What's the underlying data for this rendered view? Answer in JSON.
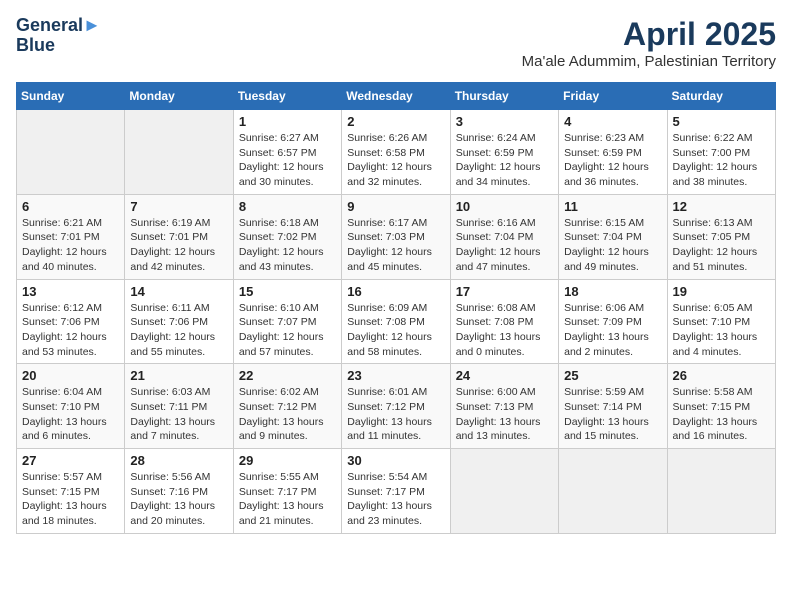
{
  "header": {
    "logo_line1": "General",
    "logo_line2": "Blue",
    "title": "April 2025",
    "subtitle": "Ma'ale Adummim, Palestinian Territory"
  },
  "weekdays": [
    "Sunday",
    "Monday",
    "Tuesday",
    "Wednesday",
    "Thursday",
    "Friday",
    "Saturday"
  ],
  "weeks": [
    [
      {
        "day": "",
        "info": ""
      },
      {
        "day": "",
        "info": ""
      },
      {
        "day": "1",
        "info": "Sunrise: 6:27 AM\nSunset: 6:57 PM\nDaylight: 12 hours and 30 minutes."
      },
      {
        "day": "2",
        "info": "Sunrise: 6:26 AM\nSunset: 6:58 PM\nDaylight: 12 hours and 32 minutes."
      },
      {
        "day": "3",
        "info": "Sunrise: 6:24 AM\nSunset: 6:59 PM\nDaylight: 12 hours and 34 minutes."
      },
      {
        "day": "4",
        "info": "Sunrise: 6:23 AM\nSunset: 6:59 PM\nDaylight: 12 hours and 36 minutes."
      },
      {
        "day": "5",
        "info": "Sunrise: 6:22 AM\nSunset: 7:00 PM\nDaylight: 12 hours and 38 minutes."
      }
    ],
    [
      {
        "day": "6",
        "info": "Sunrise: 6:21 AM\nSunset: 7:01 PM\nDaylight: 12 hours and 40 minutes."
      },
      {
        "day": "7",
        "info": "Sunrise: 6:19 AM\nSunset: 7:01 PM\nDaylight: 12 hours and 42 minutes."
      },
      {
        "day": "8",
        "info": "Sunrise: 6:18 AM\nSunset: 7:02 PM\nDaylight: 12 hours and 43 minutes."
      },
      {
        "day": "9",
        "info": "Sunrise: 6:17 AM\nSunset: 7:03 PM\nDaylight: 12 hours and 45 minutes."
      },
      {
        "day": "10",
        "info": "Sunrise: 6:16 AM\nSunset: 7:04 PM\nDaylight: 12 hours and 47 minutes."
      },
      {
        "day": "11",
        "info": "Sunrise: 6:15 AM\nSunset: 7:04 PM\nDaylight: 12 hours and 49 minutes."
      },
      {
        "day": "12",
        "info": "Sunrise: 6:13 AM\nSunset: 7:05 PM\nDaylight: 12 hours and 51 minutes."
      }
    ],
    [
      {
        "day": "13",
        "info": "Sunrise: 6:12 AM\nSunset: 7:06 PM\nDaylight: 12 hours and 53 minutes."
      },
      {
        "day": "14",
        "info": "Sunrise: 6:11 AM\nSunset: 7:06 PM\nDaylight: 12 hours and 55 minutes."
      },
      {
        "day": "15",
        "info": "Sunrise: 6:10 AM\nSunset: 7:07 PM\nDaylight: 12 hours and 57 minutes."
      },
      {
        "day": "16",
        "info": "Sunrise: 6:09 AM\nSunset: 7:08 PM\nDaylight: 12 hours and 58 minutes."
      },
      {
        "day": "17",
        "info": "Sunrise: 6:08 AM\nSunset: 7:08 PM\nDaylight: 13 hours and 0 minutes."
      },
      {
        "day": "18",
        "info": "Sunrise: 6:06 AM\nSunset: 7:09 PM\nDaylight: 13 hours and 2 minutes."
      },
      {
        "day": "19",
        "info": "Sunrise: 6:05 AM\nSunset: 7:10 PM\nDaylight: 13 hours and 4 minutes."
      }
    ],
    [
      {
        "day": "20",
        "info": "Sunrise: 6:04 AM\nSunset: 7:10 PM\nDaylight: 13 hours and 6 minutes."
      },
      {
        "day": "21",
        "info": "Sunrise: 6:03 AM\nSunset: 7:11 PM\nDaylight: 13 hours and 7 minutes."
      },
      {
        "day": "22",
        "info": "Sunrise: 6:02 AM\nSunset: 7:12 PM\nDaylight: 13 hours and 9 minutes."
      },
      {
        "day": "23",
        "info": "Sunrise: 6:01 AM\nSunset: 7:12 PM\nDaylight: 13 hours and 11 minutes."
      },
      {
        "day": "24",
        "info": "Sunrise: 6:00 AM\nSunset: 7:13 PM\nDaylight: 13 hours and 13 minutes."
      },
      {
        "day": "25",
        "info": "Sunrise: 5:59 AM\nSunset: 7:14 PM\nDaylight: 13 hours and 15 minutes."
      },
      {
        "day": "26",
        "info": "Sunrise: 5:58 AM\nSunset: 7:15 PM\nDaylight: 13 hours and 16 minutes."
      }
    ],
    [
      {
        "day": "27",
        "info": "Sunrise: 5:57 AM\nSunset: 7:15 PM\nDaylight: 13 hours and 18 minutes."
      },
      {
        "day": "28",
        "info": "Sunrise: 5:56 AM\nSunset: 7:16 PM\nDaylight: 13 hours and 20 minutes."
      },
      {
        "day": "29",
        "info": "Sunrise: 5:55 AM\nSunset: 7:17 PM\nDaylight: 13 hours and 21 minutes."
      },
      {
        "day": "30",
        "info": "Sunrise: 5:54 AM\nSunset: 7:17 PM\nDaylight: 13 hours and 23 minutes."
      },
      {
        "day": "",
        "info": ""
      },
      {
        "day": "",
        "info": ""
      },
      {
        "day": "",
        "info": ""
      }
    ]
  ]
}
